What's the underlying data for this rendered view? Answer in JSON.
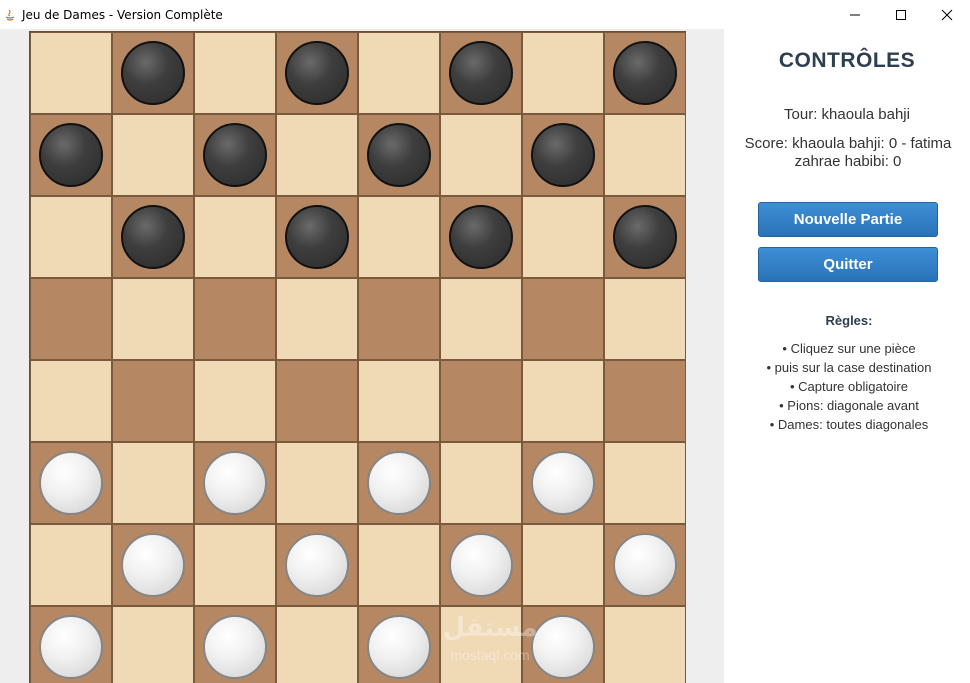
{
  "window": {
    "title": "Jeu de Dames - Version Complète"
  },
  "board": {
    "size": 8,
    "colors": {
      "light_square": "#f0d9b5",
      "dark_square": "#b58863",
      "black_piece": "#2e2e2e",
      "white_piece": "#f0f0f0"
    },
    "rows": [
      [
        "",
        "b",
        "",
        "b",
        "",
        "b",
        "",
        "b"
      ],
      [
        "b",
        "",
        "b",
        "",
        "b",
        "",
        "b",
        ""
      ],
      [
        "",
        "b",
        "",
        "b",
        "",
        "b",
        "",
        "b"
      ],
      [
        "",
        "",
        "",
        "",
        "",
        "",
        "",
        ""
      ],
      [
        "",
        "",
        "",
        "",
        "",
        "",
        "",
        ""
      ],
      [
        "w",
        "",
        "w",
        "",
        "w",
        "",
        "w",
        ""
      ],
      [
        "",
        "w",
        "",
        "w",
        "",
        "w",
        "",
        "w"
      ],
      [
        "w",
        "",
        "w",
        "",
        "w",
        "",
        "w",
        ""
      ]
    ]
  },
  "panel": {
    "title": "CONTRÔLES",
    "turn": "Tour: khaoula bahji",
    "score": "Score: khaoula bahji: 0 - fatima zahrae habibi: 0",
    "buttons": {
      "new_game": "Nouvelle Partie",
      "quit": "Quitter"
    },
    "accent_color": "#2a72b8",
    "rules_title": "Règles:",
    "rules": [
      "• Cliquez sur une pièce",
      "• puis sur la case destination",
      "• Capture obligatoire",
      "• Pions: diagonale avant",
      "• Dames: toutes diagonales"
    ]
  },
  "watermark": {
    "line1": "مستقل",
    "line2": "mostaql.com"
  }
}
